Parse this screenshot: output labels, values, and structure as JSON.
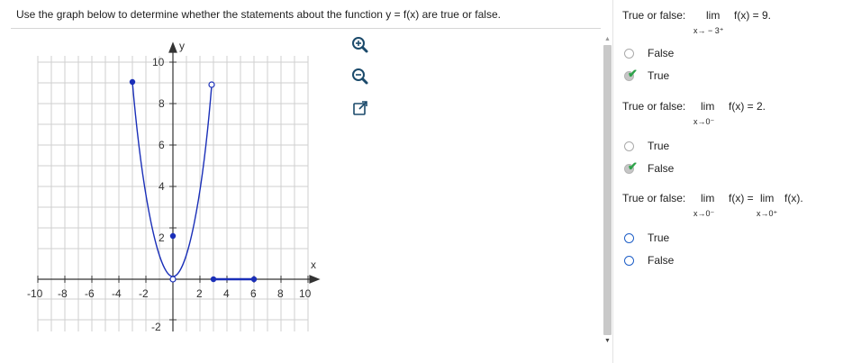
{
  "instruction": "Use the graph below to determine whether the statements about the function y = f(x) are true or false.",
  "graph": {
    "y_label": "y",
    "x_label": "x",
    "x_ticks": [
      "-10",
      "-8",
      "-6",
      "-4",
      "-2",
      "2",
      "4",
      "6",
      "8",
      "10"
    ],
    "y_ticks": [
      "10",
      "8",
      "6",
      "4",
      "2",
      "-2"
    ]
  },
  "tools": [
    "zoom-in-icon",
    "zoom-out-icon",
    "popout-icon"
  ],
  "questions": [
    {
      "prefix": "True or false:",
      "lim": "lim",
      "expr": "f(x) = 9.",
      "sub": "x→ − 3⁺",
      "options": [
        {
          "label": "False",
          "state": "unselected"
        },
        {
          "label": "True",
          "state": "correct"
        }
      ]
    },
    {
      "prefix": "True or false:",
      "lim": "lim",
      "expr": "f(x) = 2.",
      "sub": "x→0⁻",
      "options": [
        {
          "label": "True",
          "state": "unselected"
        },
        {
          "label": "False",
          "state": "correct"
        }
      ]
    },
    {
      "prefix": "True or false:",
      "lim": "lim",
      "expr": "f(x) =",
      "lim2": "lim",
      "expr2": "f(x).",
      "sub": "x→0⁻",
      "sub2": "x→0⁺",
      "options": [
        {
          "label": "True",
          "state": "open"
        },
        {
          "label": "False",
          "state": "open"
        }
      ]
    }
  ]
}
